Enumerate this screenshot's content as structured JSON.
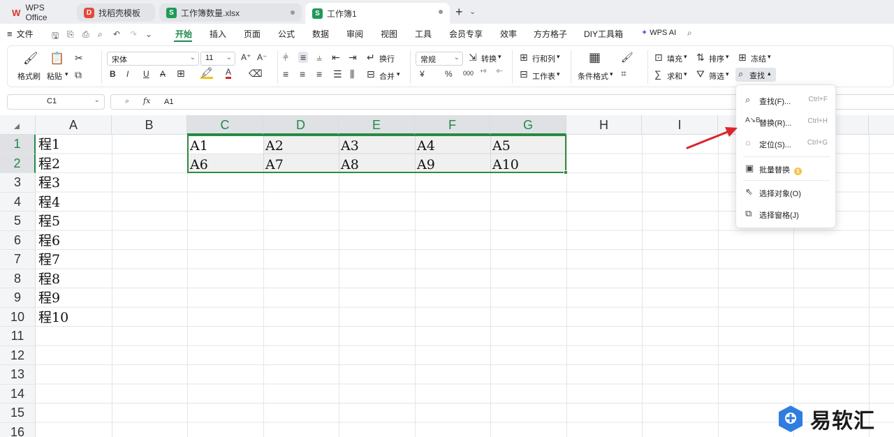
{
  "tabs": [
    {
      "label": "WPS Office",
      "icon": "wps-logo-icon"
    },
    {
      "label": "找稻壳模板",
      "icon": "docer-icon"
    },
    {
      "label": "工作簿数量.xlsx",
      "icon": "sheet-icon"
    },
    {
      "label": "工作簿1",
      "icon": "sheet-icon"
    }
  ],
  "menu": {
    "file": "文件",
    "items": [
      "开始",
      "插入",
      "页面",
      "公式",
      "数据",
      "审阅",
      "视图",
      "工具",
      "会员专享",
      "效率",
      "方方格子",
      "DIY工具箱"
    ],
    "active": "开始",
    "wps_ai": "WPS AI"
  },
  "ribbon": {
    "format_painter": "格式刷",
    "paste": "粘贴",
    "font_name": "宋体",
    "font_size": "11",
    "wrap": "换行",
    "merge": "合并",
    "number_format": "常规",
    "convert": "转换",
    "rows_cols": "行和列",
    "worksheet": "工作表",
    "conditional_format": "条件格式",
    "fill": "填充",
    "sort": "排序",
    "freeze": "冻结",
    "sum": "求和",
    "filter": "筛选",
    "find": "查找",
    "currency_symbol": "¥",
    "percent_symbol": "%",
    "thousands_symbol": "000"
  },
  "formula_bar": {
    "cell_ref": "C1",
    "fx": "fx",
    "value": "A1"
  },
  "grid": {
    "columns": [
      "A",
      "B",
      "C",
      "D",
      "E",
      "F",
      "G",
      "H",
      "I"
    ],
    "rows": [
      "1",
      "2",
      "3",
      "4",
      "5",
      "6",
      "7",
      "8",
      "9",
      "10",
      "11",
      "12",
      "13",
      "14",
      "15",
      "16"
    ],
    "colA": [
      "程1",
      "程2",
      "程3",
      "程4",
      "程5",
      "程6",
      "程7",
      "程8",
      "程9",
      "程10"
    ],
    "row1": [
      "A1",
      "A2",
      "A3",
      "A4",
      "A5"
    ],
    "row2": [
      "A6",
      "A7",
      "A8",
      "A9",
      "A10"
    ]
  },
  "find_menu": [
    {
      "label": "查找(F)...",
      "shortcut": "Ctrl+F",
      "icon": "search-icon"
    },
    {
      "label": "替换(R)...",
      "shortcut": "Ctrl+H",
      "icon": "replace-icon"
    },
    {
      "label": "定位(S)...",
      "shortcut": "Ctrl+G",
      "icon": "locate-icon"
    },
    {
      "label": "批量替换",
      "shortcut": "",
      "icon": "batch-replace-icon"
    },
    {
      "label": "选择对象(O)",
      "shortcut": "",
      "icon": "select-object-icon"
    },
    {
      "label": "选择窗格(J)",
      "shortcut": "",
      "icon": "selection-pane-icon"
    }
  ],
  "watermark": "易软汇",
  "colors": {
    "accent": "#1f8a4c",
    "selection_border": "#2f8a3f",
    "annotation_arrow": "#d9262b"
  }
}
